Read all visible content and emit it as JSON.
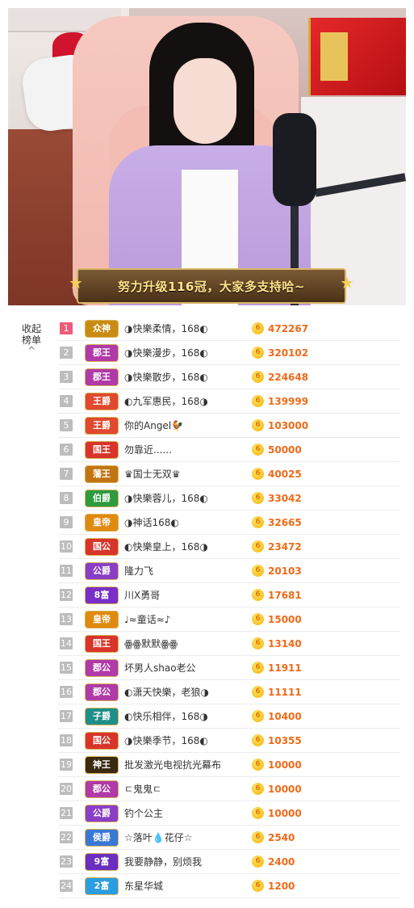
{
  "stream": {
    "banner_text": "努力升级116冠，大家多支持哈~"
  },
  "panel": {
    "collapse_label": "收起榜单",
    "caret": "^"
  },
  "colors": {
    "score": "#f06a18",
    "rank_top": "#ee5b7a"
  },
  "ranking": [
    {
      "rank": "1",
      "badge": "众神",
      "badge_color": "#c98b12",
      "name": "◑快樂柔情，168◐",
      "score": "472267"
    },
    {
      "rank": "2",
      "badge": "郡王",
      "badge_color": "#b03aa8",
      "name": "◑快樂漫步，168◐",
      "score": "320102"
    },
    {
      "rank": "3",
      "badge": "郡王",
      "badge_color": "#b03aa8",
      "name": "◑快樂散步，168◐",
      "score": "224648"
    },
    {
      "rank": "4",
      "badge": "王爵",
      "badge_color": "#e0492e",
      "name": "◐九军惠民，168◑",
      "score": "139999"
    },
    {
      "rank": "5",
      "badge": "王爵",
      "badge_color": "#e0492e",
      "name": "你的Angel🐓",
      "score": "103000"
    },
    {
      "rank": "6",
      "badge": "国王",
      "badge_color": "#d8342a",
      "name": "勿靠近......",
      "score": "50000"
    },
    {
      "rank": "7",
      "badge": "藩王",
      "badge_color": "#c27412",
      "name": "♛国士无双♛",
      "score": "40025"
    },
    {
      "rank": "8",
      "badge": "伯爵",
      "badge_color": "#2e9b3e",
      "name": "◑快樂蓉儿，168◐",
      "score": "33042"
    },
    {
      "rank": "9",
      "badge": "皇帝",
      "badge_color": "#e08a10",
      "name": "◑神话168◐",
      "score": "32665"
    },
    {
      "rank": "10",
      "badge": "国公",
      "badge_color": "#d8342a",
      "name": "◐快樂皇上，168◑",
      "score": "23472"
    },
    {
      "rank": "11",
      "badge": "公爵",
      "badge_color": "#8a3ec6",
      "name": "隆力飞",
      "score": "20103"
    },
    {
      "rank": "12",
      "badge": "8富",
      "badge_color": "#7a2ec8",
      "name": "川X勇哥",
      "score": "17681"
    },
    {
      "rank": "13",
      "badge": "皇帝",
      "badge_color": "#e08a10",
      "name": "♩≈童话≈♪",
      "score": "15000"
    },
    {
      "rank": "14",
      "badge": "国王",
      "badge_color": "#d8342a",
      "name": "ꙮꙮ默默ꙮꙮ",
      "score": "13140"
    },
    {
      "rank": "15",
      "badge": "郡公",
      "badge_color": "#b03aa8",
      "name": "坏男人shao老公",
      "score": "11911"
    },
    {
      "rank": "16",
      "badge": "郡公",
      "badge_color": "#b03aa8",
      "name": "◐潇天快樂，老狼◑",
      "score": "11111"
    },
    {
      "rank": "17",
      "badge": "子爵",
      "badge_color": "#1f8f8a",
      "name": "◐快乐相伴，168◑",
      "score": "10400"
    },
    {
      "rank": "18",
      "badge": "国公",
      "badge_color": "#d8342a",
      "name": "◑快樂季节，168◐",
      "score": "10355"
    },
    {
      "rank": "19",
      "badge": "神王",
      "badge_color": "#3a2a12",
      "name": "批发激光电视抗光幕布",
      "score": "10000"
    },
    {
      "rank": "20",
      "badge": "郡公",
      "badge_color": "#b03aa8",
      "name": "ㄷ鬼鬼ㄷ",
      "score": "10000"
    },
    {
      "rank": "21",
      "badge": "公爵",
      "badge_color": "#8a3ec6",
      "name": "钓个公主",
      "score": "10000"
    },
    {
      "rank": "22",
      "badge": "侯爵",
      "badge_color": "#3a78d6",
      "name": "☆落叶💧花仔☆",
      "score": "2540"
    },
    {
      "rank": "23",
      "badge": "9富",
      "badge_color": "#6a2ec0",
      "name": "我要静静，别烦我",
      "score": "2400"
    },
    {
      "rank": "24",
      "badge": "2富",
      "badge_color": "#2a9de0",
      "name": "东星华城",
      "score": "1200"
    }
  ]
}
